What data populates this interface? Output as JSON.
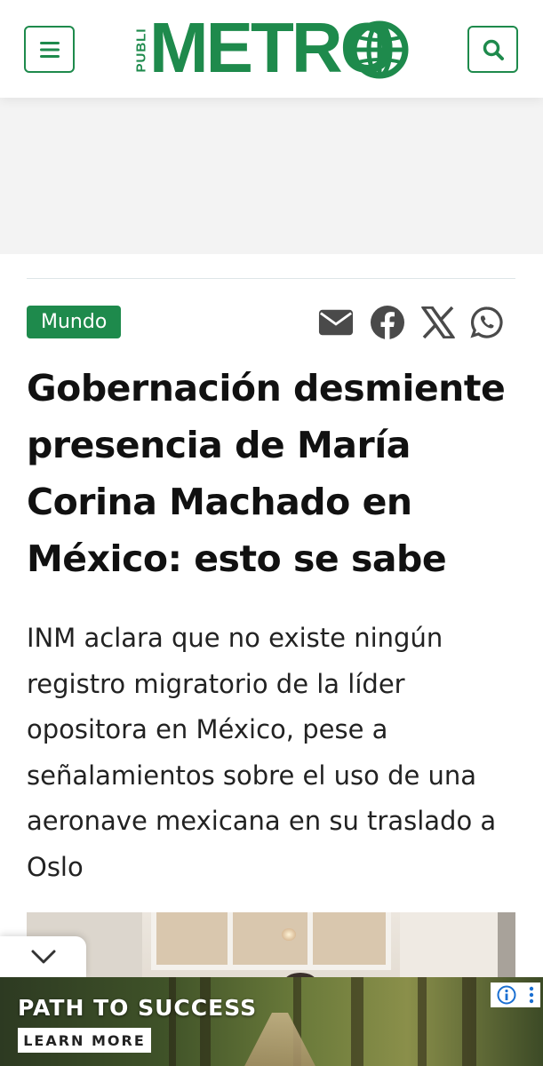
{
  "header": {
    "logo": {
      "prefix": "PUBLI",
      "wordmark": "METRO",
      "globe_icon": "globe-icon"
    },
    "menu_icon": "hamburger-menu-icon",
    "search_icon": "search-icon"
  },
  "article": {
    "category": "Mundo",
    "share_icons": [
      "email-icon",
      "facebook-icon",
      "x-icon",
      "whatsapp-icon"
    ],
    "headline_lines": [
      "Gobernación desmiente",
      "presencia de María",
      "Corina Machado en",
      "México: esto se sabe"
    ],
    "summary_lines": [
      "INM aclara que no existe ningún",
      "registro migratorio de la líder",
      "opositora en México, pese a",
      "señalamientos sobre el uso de una",
      "aeronave mexicana en su traslado a",
      "Oslo"
    ]
  },
  "collapse_icon": "chevron-down-icon",
  "bottom_ad": {
    "headline": "PATH TO SUCCESS",
    "cta": "LEARN MORE",
    "info_icon": "info-icon",
    "more_icon": "kebab-menu-icon"
  },
  "colors": {
    "brand_green": "#1e8a4c",
    "share_icon_gray": "#4a4a4a"
  }
}
